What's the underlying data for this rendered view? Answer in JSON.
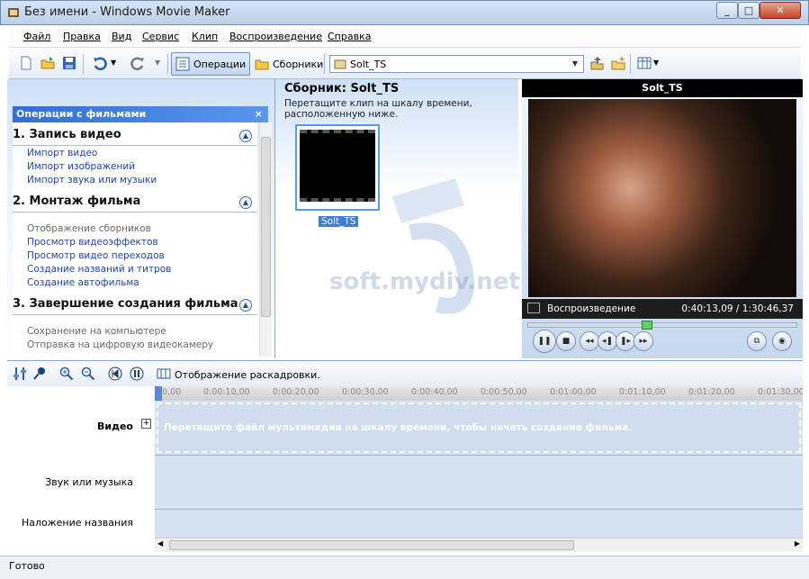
{
  "window": {
    "title": "Без имени - Windows Movie Maker"
  },
  "menu": [
    "Файл",
    "Правка",
    "Вид",
    "Сервис",
    "Клип",
    "Воспроизведение",
    "Справка"
  ],
  "toolbar": {
    "operations_label": "Операции",
    "collections_label": "Сборники",
    "collection_selected": "Solt_TS"
  },
  "tasks": {
    "header": "Операции с фильмами",
    "close": "×",
    "sections": [
      {
        "title": "1. Запись видео",
        "links": [
          "Импорт видео",
          "Импорт изображений",
          "Импорт звука или музыки"
        ]
      },
      {
        "title": "2. Монтаж фильма",
        "links": [
          "Отображение сборников",
          "Просмотр видеоэффектов",
          "Просмотр видео переходов",
          "Создание названий и титров",
          "Создание автофильма"
        ]
      },
      {
        "title": "3. Завершение создания фильма",
        "links": [
          "Сохранение на компьютере",
          "Отправка на цифровую видеокамеру"
        ]
      }
    ]
  },
  "collection": {
    "title": "Сборник: Solt_TS",
    "hint": "Перетащите клип на шкалу времени, расположенную ниже.",
    "clip_name": "Solt_TS",
    "watermark": "soft.mydiv.net"
  },
  "preview": {
    "title": "Solt_TS",
    "status": "Воспроизведение",
    "time": "0:40:13,09 / 1:30:46,37",
    "position_fraction": 0.44
  },
  "timeline": {
    "mode_label": "Отображение раскадровки.",
    "ruler": [
      "0,00",
      "0:00:10,00",
      "0:00:20,00",
      "0:00:30,00",
      "0:00:40,00",
      "0:00:50,00",
      "0:01:00,00",
      "0:01:10,00",
      "0:01:20,00",
      "0:01:30,00"
    ],
    "tracks": {
      "video": "Видео",
      "audio": "Звук или музыка",
      "title_overlay": "Наложение названия"
    },
    "drop_hint": "Перетащите файл мультимедиа на шкалу времени, чтобы начать создание фильма."
  },
  "status": "Готово"
}
